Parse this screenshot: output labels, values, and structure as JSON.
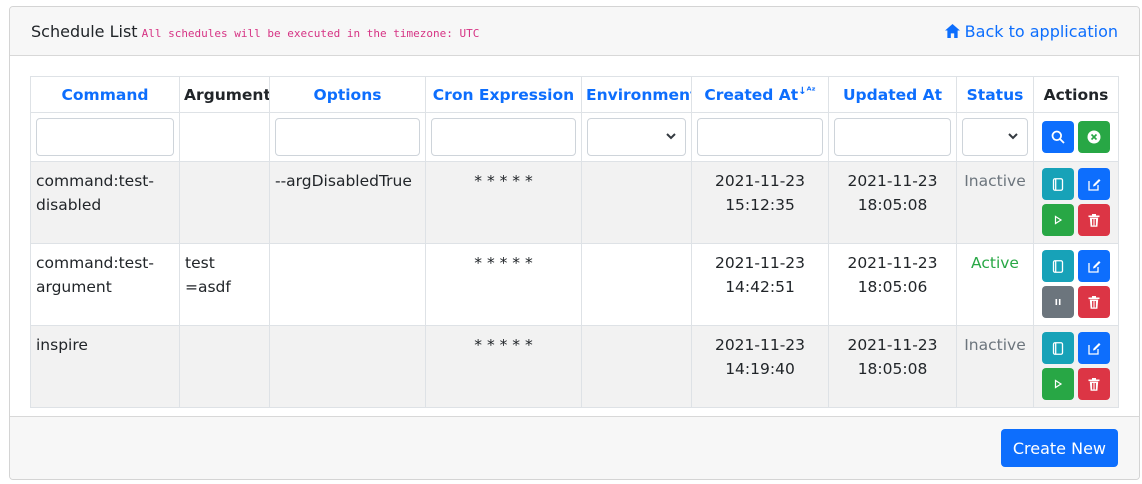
{
  "header": {
    "title": "Schedule List",
    "timezone_note": "All schedules will be executed in the timezone: UTC",
    "back_link": "Back to application"
  },
  "table": {
    "columns": [
      {
        "label": "Command",
        "sortable": true
      },
      {
        "label": "Arguments",
        "sortable": false
      },
      {
        "label": "Options",
        "sortable": true
      },
      {
        "label": "Cron Expression",
        "sortable": true
      },
      {
        "label": "Environments",
        "sortable": true
      },
      {
        "label": "Created At",
        "sortable": true,
        "sorted": "asc"
      },
      {
        "label": "Updated At",
        "sortable": true
      },
      {
        "label": "Status",
        "sortable": true
      },
      {
        "label": "Actions",
        "sortable": false
      }
    ],
    "rows": [
      {
        "command": "command:test-disabled",
        "arguments": "",
        "options": "--argDisabledTrue",
        "cron": "* * * * *",
        "environments": "",
        "created_date": "2021-11-23",
        "created_time": "15:12:35",
        "updated_date": "2021-11-23",
        "updated_time": "18:05:08",
        "status": "Inactive"
      },
      {
        "command": "command:test-argument",
        "arguments": "test =asdf",
        "options": "",
        "cron": "* * * * *",
        "environments": "",
        "created_date": "2021-11-23",
        "created_time": "14:42:51",
        "updated_date": "2021-11-23",
        "updated_time": "18:05:06",
        "status": "Active"
      },
      {
        "command": "inspire",
        "arguments": "",
        "options": "",
        "cron": "* * * * *",
        "environments": "",
        "created_date": "2021-11-23",
        "created_time": "14:19:40",
        "updated_date": "2021-11-23",
        "updated_time": "18:05:08",
        "status": "Inactive"
      }
    ]
  },
  "footer": {
    "create_label": "Create New"
  },
  "colors": {
    "primary": "#0d6efd",
    "success": "#28a745",
    "info": "#17a2b8",
    "danger": "#dc3545",
    "secondary": "#6c757d",
    "note": "#d63384"
  },
  "icons": {
    "back": "home-icon",
    "search": "search-icon",
    "clear": "close-circle-icon",
    "history": "notebook-icon",
    "edit": "edit-icon",
    "run": "play-icon",
    "pause": "pause-icon",
    "delete": "trash-icon",
    "sort": "sort-alpha-down-icon"
  }
}
